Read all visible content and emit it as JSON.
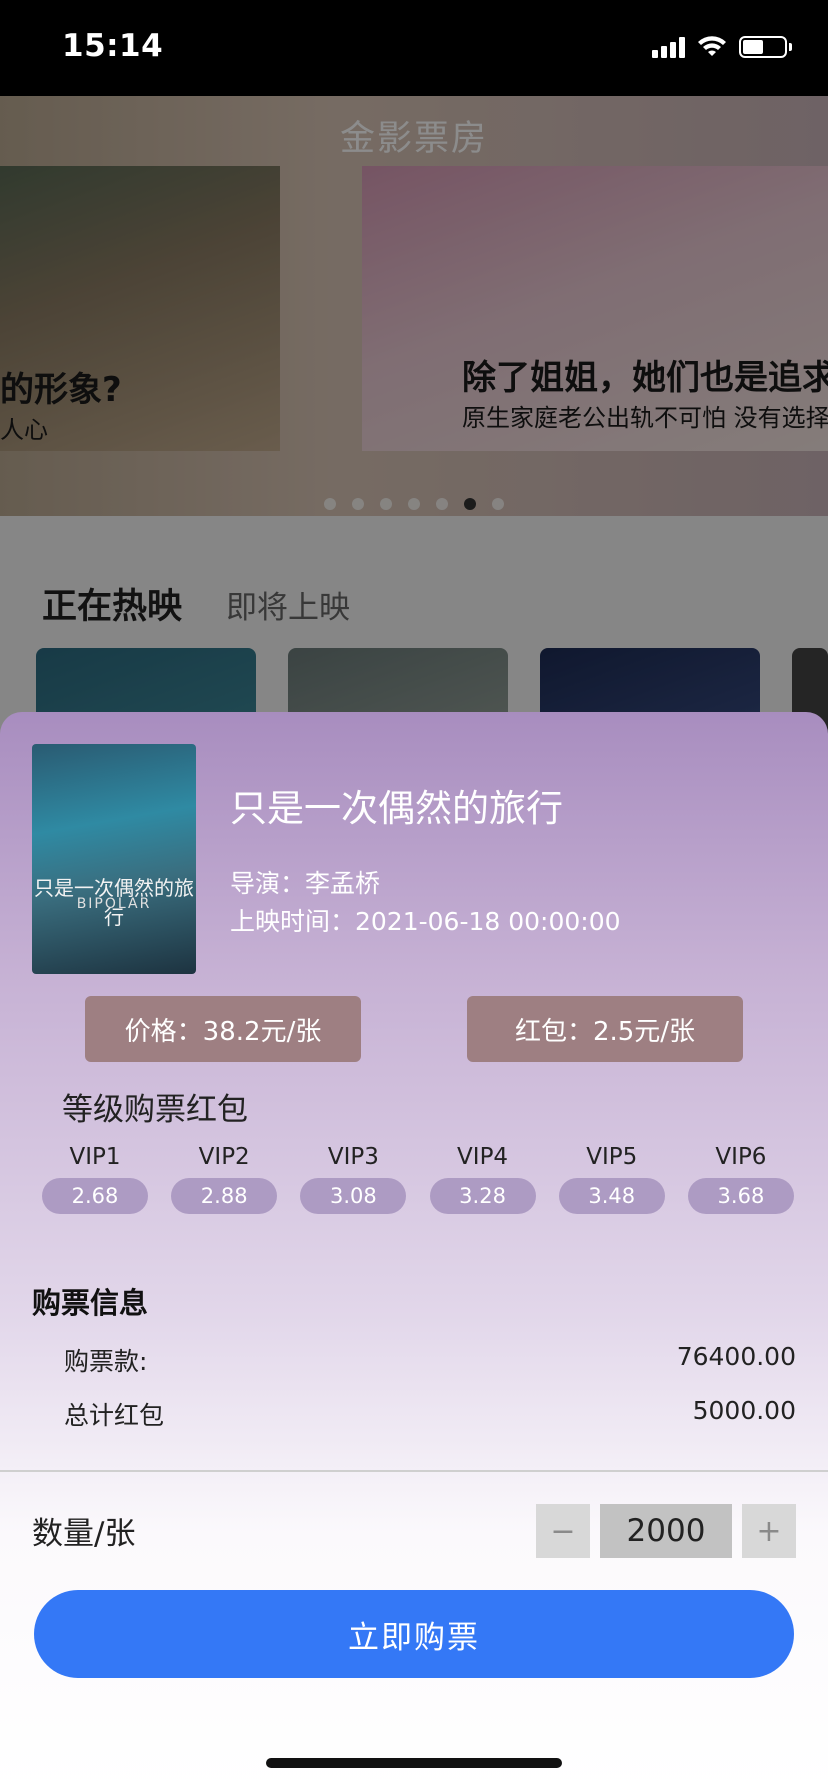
{
  "status_bar": {
    "time": "15:14"
  },
  "header": {
    "title": "金影票房"
  },
  "banner": {
    "left_caption": "的形象?",
    "left_subcaption": "人心",
    "right_caption": "除了姐姐，她们也是追求独",
    "right_subcaption": "原生家庭老公出轨不可怕 没有选择"
  },
  "tabs": {
    "active": "正在热映",
    "inactive": "即将上映"
  },
  "movie": {
    "poster_caption": "只是一次偶然的旅行",
    "poster_subcaption": "BIPOLAR",
    "title": "只是一次偶然的旅行",
    "director": "导演：李孟桥",
    "release": "上映时间：2021-06-18 00:00:00",
    "price": "价格：38.2元/张",
    "red_packet": "红包：2.5元/张"
  },
  "vip": {
    "heading": "等级购票红包",
    "levels": [
      {
        "name": "VIP1",
        "value": "2.68"
      },
      {
        "name": "VIP2",
        "value": "2.88"
      },
      {
        "name": "VIP3",
        "value": "3.08"
      },
      {
        "name": "VIP4",
        "value": "3.28"
      },
      {
        "name": "VIP5",
        "value": "3.48"
      },
      {
        "name": "VIP6",
        "value": "3.68"
      }
    ]
  },
  "purchase": {
    "heading": "购票信息",
    "payment_label": "购票款:",
    "payment_value": "76400.00",
    "total_red_label": "总计红包",
    "total_red_value": "5000.00"
  },
  "quantity": {
    "label": "数量/张",
    "value": "2000",
    "minus": "−",
    "plus": "+"
  },
  "buy_button": {
    "label": "立即购票"
  }
}
